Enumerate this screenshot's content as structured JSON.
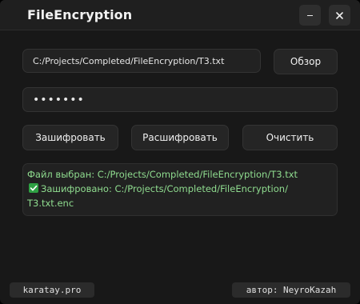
{
  "window": {
    "title": "FileEncryption",
    "minimize_glyph": "–",
    "close_glyph": "✕"
  },
  "path": {
    "value": "C:/Projects/Completed/FileEncryption/T3.txt"
  },
  "browse": {
    "label": "Обзор"
  },
  "password": {
    "masked_value": "•••••••"
  },
  "actions": {
    "encrypt_label": "Зашифровать",
    "decrypt_label": "Расшифровать",
    "clear_label": "Очистить"
  },
  "log": {
    "line1": "Файл выбран: C:/Projects/Completed/FileEncryption/T3.txt",
    "line2": "Зашифровано: C:/Projects/Completed/FileEncryption/",
    "line3": "T3.txt.enc",
    "check_icon": "check-mark-icon"
  },
  "footer": {
    "site": "karatay.pro",
    "author": "автор: NeyroKazah"
  },
  "colors": {
    "background": "#181818",
    "log_text": "#8fdc8f",
    "check": "#2ea043"
  }
}
